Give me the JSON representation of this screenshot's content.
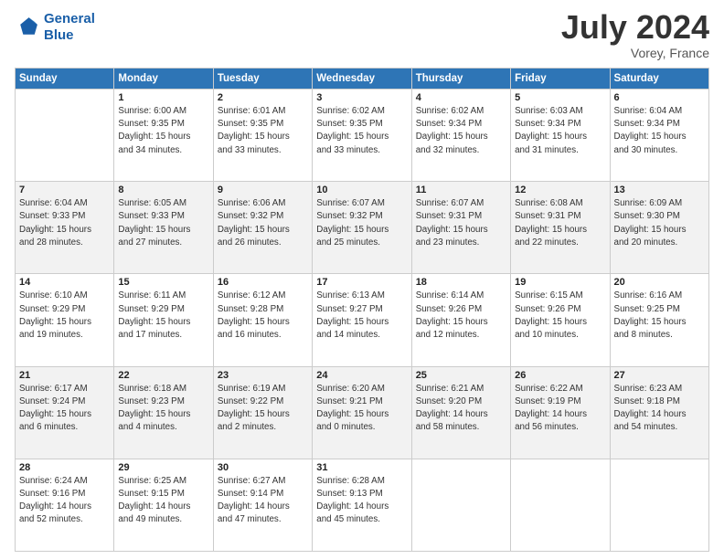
{
  "header": {
    "logo_line1": "General",
    "logo_line2": "Blue",
    "title": "July 2024",
    "location": "Vorey, France"
  },
  "days_of_week": [
    "Sunday",
    "Monday",
    "Tuesday",
    "Wednesday",
    "Thursday",
    "Friday",
    "Saturday"
  ],
  "weeks": [
    [
      {
        "day": "",
        "info": ""
      },
      {
        "day": "1",
        "info": "Sunrise: 6:00 AM\nSunset: 9:35 PM\nDaylight: 15 hours\nand 34 minutes."
      },
      {
        "day": "2",
        "info": "Sunrise: 6:01 AM\nSunset: 9:35 PM\nDaylight: 15 hours\nand 33 minutes."
      },
      {
        "day": "3",
        "info": "Sunrise: 6:02 AM\nSunset: 9:35 PM\nDaylight: 15 hours\nand 33 minutes."
      },
      {
        "day": "4",
        "info": "Sunrise: 6:02 AM\nSunset: 9:34 PM\nDaylight: 15 hours\nand 32 minutes."
      },
      {
        "day": "5",
        "info": "Sunrise: 6:03 AM\nSunset: 9:34 PM\nDaylight: 15 hours\nand 31 minutes."
      },
      {
        "day": "6",
        "info": "Sunrise: 6:04 AM\nSunset: 9:34 PM\nDaylight: 15 hours\nand 30 minutes."
      }
    ],
    [
      {
        "day": "7",
        "info": "Sunrise: 6:04 AM\nSunset: 9:33 PM\nDaylight: 15 hours\nand 28 minutes."
      },
      {
        "day": "8",
        "info": "Sunrise: 6:05 AM\nSunset: 9:33 PM\nDaylight: 15 hours\nand 27 minutes."
      },
      {
        "day": "9",
        "info": "Sunrise: 6:06 AM\nSunset: 9:32 PM\nDaylight: 15 hours\nand 26 minutes."
      },
      {
        "day": "10",
        "info": "Sunrise: 6:07 AM\nSunset: 9:32 PM\nDaylight: 15 hours\nand 25 minutes."
      },
      {
        "day": "11",
        "info": "Sunrise: 6:07 AM\nSunset: 9:31 PM\nDaylight: 15 hours\nand 23 minutes."
      },
      {
        "day": "12",
        "info": "Sunrise: 6:08 AM\nSunset: 9:31 PM\nDaylight: 15 hours\nand 22 minutes."
      },
      {
        "day": "13",
        "info": "Sunrise: 6:09 AM\nSunset: 9:30 PM\nDaylight: 15 hours\nand 20 minutes."
      }
    ],
    [
      {
        "day": "14",
        "info": "Sunrise: 6:10 AM\nSunset: 9:29 PM\nDaylight: 15 hours\nand 19 minutes."
      },
      {
        "day": "15",
        "info": "Sunrise: 6:11 AM\nSunset: 9:29 PM\nDaylight: 15 hours\nand 17 minutes."
      },
      {
        "day": "16",
        "info": "Sunrise: 6:12 AM\nSunset: 9:28 PM\nDaylight: 15 hours\nand 16 minutes."
      },
      {
        "day": "17",
        "info": "Sunrise: 6:13 AM\nSunset: 9:27 PM\nDaylight: 15 hours\nand 14 minutes."
      },
      {
        "day": "18",
        "info": "Sunrise: 6:14 AM\nSunset: 9:26 PM\nDaylight: 15 hours\nand 12 minutes."
      },
      {
        "day": "19",
        "info": "Sunrise: 6:15 AM\nSunset: 9:26 PM\nDaylight: 15 hours\nand 10 minutes."
      },
      {
        "day": "20",
        "info": "Sunrise: 6:16 AM\nSunset: 9:25 PM\nDaylight: 15 hours\nand 8 minutes."
      }
    ],
    [
      {
        "day": "21",
        "info": "Sunrise: 6:17 AM\nSunset: 9:24 PM\nDaylight: 15 hours\nand 6 minutes."
      },
      {
        "day": "22",
        "info": "Sunrise: 6:18 AM\nSunset: 9:23 PM\nDaylight: 15 hours\nand 4 minutes."
      },
      {
        "day": "23",
        "info": "Sunrise: 6:19 AM\nSunset: 9:22 PM\nDaylight: 15 hours\nand 2 minutes."
      },
      {
        "day": "24",
        "info": "Sunrise: 6:20 AM\nSunset: 9:21 PM\nDaylight: 15 hours\nand 0 minutes."
      },
      {
        "day": "25",
        "info": "Sunrise: 6:21 AM\nSunset: 9:20 PM\nDaylight: 14 hours\nand 58 minutes."
      },
      {
        "day": "26",
        "info": "Sunrise: 6:22 AM\nSunset: 9:19 PM\nDaylight: 14 hours\nand 56 minutes."
      },
      {
        "day": "27",
        "info": "Sunrise: 6:23 AM\nSunset: 9:18 PM\nDaylight: 14 hours\nand 54 minutes."
      }
    ],
    [
      {
        "day": "28",
        "info": "Sunrise: 6:24 AM\nSunset: 9:16 PM\nDaylight: 14 hours\nand 52 minutes."
      },
      {
        "day": "29",
        "info": "Sunrise: 6:25 AM\nSunset: 9:15 PM\nDaylight: 14 hours\nand 49 minutes."
      },
      {
        "day": "30",
        "info": "Sunrise: 6:27 AM\nSunset: 9:14 PM\nDaylight: 14 hours\nand 47 minutes."
      },
      {
        "day": "31",
        "info": "Sunrise: 6:28 AM\nSunset: 9:13 PM\nDaylight: 14 hours\nand 45 minutes."
      },
      {
        "day": "",
        "info": ""
      },
      {
        "day": "",
        "info": ""
      },
      {
        "day": "",
        "info": ""
      }
    ]
  ]
}
